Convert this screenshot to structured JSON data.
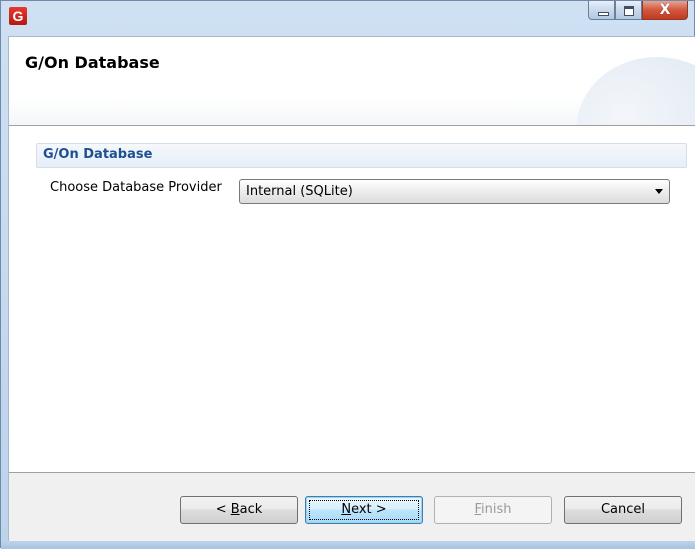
{
  "window": {
    "app_icon_letter": "G",
    "caption_buttons": {
      "minimize": "minimize",
      "maximize": "maximize",
      "close": "X"
    }
  },
  "header": {
    "title": "G/On Database"
  },
  "group": {
    "title": "G/On Database"
  },
  "provider": {
    "label": "Choose Database Provider",
    "selected": "Internal (SQLite)"
  },
  "footer": {
    "back": {
      "prefix": "< ",
      "mnemonic": "B",
      "rest": "ack"
    },
    "next": {
      "mnemonic": "N",
      "rest": "ext >"
    },
    "finish": {
      "mnemonic": "F",
      "rest": "inish"
    },
    "cancel": "Cancel"
  }
}
